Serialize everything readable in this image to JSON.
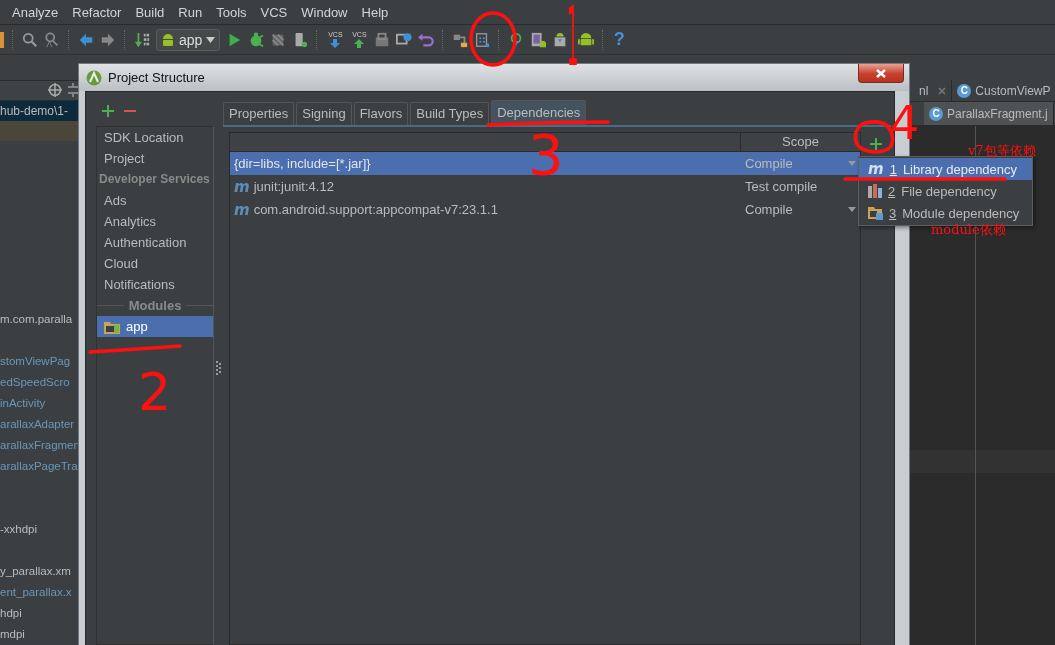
{
  "menu_bar": [
    "Analyze",
    "Refactor",
    "Build",
    "Run",
    "Tools",
    "VCS",
    "Window",
    "Help"
  ],
  "toolbar": {
    "run_config": "app",
    "vcs_labels": [
      "VCS",
      "VCS"
    ],
    "help_glyph": "?"
  },
  "project_tree": {
    "breadcrumb": "hub-demo\\1-",
    "items": [
      {
        "label": "m.com.paralla",
        "color": "#bbbbbb"
      },
      {
        "label": "stomViewPag",
        "color": "#6897bb"
      },
      {
        "label": "edSpeedScro",
        "color": "#6897bb"
      },
      {
        "label": "inActivity",
        "color": "#6897bb"
      },
      {
        "label": "arallaxAdapter",
        "color": "#6897bb"
      },
      {
        "label": "arallaxFragmen",
        "color": "#6897bb"
      },
      {
        "label": "arallaxPageTra",
        "color": "#6897bb"
      },
      {
        "label": "-xxhdpi",
        "color": "#bbbbbb"
      },
      {
        "label": "y_parallax.xm",
        "color": "#bbbbbb"
      },
      {
        "label": "ent_parallax.x",
        "color": "#6897bb"
      },
      {
        "label": "hdpi",
        "color": "#bbbbbb"
      },
      {
        "label": "mdpi",
        "color": "#bbbbbb"
      }
    ]
  },
  "editor": {
    "tabs": [
      {
        "label": "nl",
        "closable": true,
        "selected": false
      },
      {
        "label": "CustomViewP",
        "icon_letter": "C",
        "closable": false,
        "selected": false
      }
    ],
    "second_row_tabs": [
      {
        "label": "ParallaxFragment.j",
        "icon_letter": "C",
        "selected": true
      }
    ]
  },
  "dialog": {
    "title": "Project Structure",
    "sidebar": [
      {
        "kind": "item",
        "label": "SDK Location",
        "selected": false
      },
      {
        "kind": "item",
        "label": "Project",
        "selected": false
      },
      {
        "kind": "header",
        "label": "Developer Services"
      },
      {
        "kind": "item",
        "label": "Ads",
        "selected": false
      },
      {
        "kind": "item",
        "label": "Analytics",
        "selected": false
      },
      {
        "kind": "item",
        "label": "Authentication",
        "selected": false
      },
      {
        "kind": "item",
        "label": "Cloud",
        "selected": false
      },
      {
        "kind": "item",
        "label": "Notifications",
        "selected": false
      },
      {
        "kind": "separator",
        "label": "Modules"
      },
      {
        "kind": "module",
        "label": "app",
        "selected": true
      }
    ],
    "tabs": [
      {
        "label": "Properties",
        "selected": false
      },
      {
        "label": "Signing",
        "selected": false
      },
      {
        "label": "Flavors",
        "selected": false
      },
      {
        "label": "Build Types",
        "selected": false
      },
      {
        "label": "Dependencies",
        "selected": true
      }
    ],
    "table": {
      "scope_header": "Scope",
      "rows": [
        {
          "kind": "jar",
          "name": "{dir=libs, include=[*.jar]}",
          "scope": "Compile",
          "has_dropdown": true,
          "selected": true
        },
        {
          "kind": "maven",
          "icon_letter": "m",
          "name": "junit:junit:4.12",
          "scope": "Test compile",
          "has_dropdown": false,
          "selected": false
        },
        {
          "kind": "maven",
          "icon_letter": "m",
          "name": "com.android.support:appcompat-v7:23.1.1",
          "scope": "Compile",
          "has_dropdown": true,
          "selected": false
        }
      ]
    }
  },
  "add_menu": {
    "items": [
      {
        "kind": "library",
        "icon_letter": "m",
        "key": "1",
        "label": "Library dependency",
        "selected": true
      },
      {
        "kind": "file",
        "key": "2",
        "label": "File dependency",
        "selected": false
      },
      {
        "kind": "module",
        "key": "3",
        "label": "Module dependency",
        "selected": false
      }
    ]
  },
  "annotations": {
    "marks": [
      "1",
      "2",
      "3",
      "4"
    ],
    "notes": [
      "v7包等依赖",
      "module依赖"
    ]
  }
}
